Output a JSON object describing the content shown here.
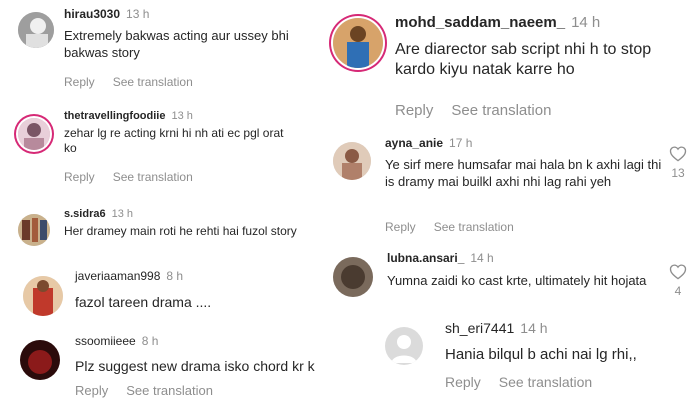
{
  "comments": [
    {
      "username": "hirau3030",
      "time": "13 h",
      "text": "Extremely bakwas acting aur ussey bhi bakwas story",
      "reply": "Reply",
      "translate": "See translation"
    },
    {
      "username": "thetravellingfoodiie",
      "time": "13 h",
      "text": "zehar lg re acting krni hi nh ati ec pgl orat ko",
      "reply": "Reply",
      "translate": "See translation"
    },
    {
      "username": "s.sidra6",
      "time": "13 h",
      "text": "Her dramey main roti he rehti hai fuzol story"
    },
    {
      "username": "javeriaaman998",
      "time": "8 h",
      "text": "fazol tareen drama ...."
    },
    {
      "username": "ssoomiieee",
      "time": "8 h",
      "text": "Plz suggest new drama isko chord kr k",
      "reply": "Reply",
      "translate": "See translation"
    },
    {
      "username": "mohd_saddam_naeem_",
      "time": "14 h",
      "text": "Are diarector sab script nhi h to stop kardo kiyu natak karre ho",
      "reply": "Reply",
      "translate": "See translation"
    },
    {
      "username": "ayna_anie",
      "time": "17 h",
      "text": "Ye sirf mere humsafar mai hala bn k axhi lagi thi is dramy mai builkl axhi nhi lag rahi yeh",
      "reply": "Reply",
      "translate": "See translation",
      "likes": "13"
    },
    {
      "username": "lubna.ansari_",
      "time": "14 h",
      "text": "Yumna zaidi ko cast krte, ultimately hit hojata",
      "likes": "4"
    },
    {
      "username": "sh_eri7441",
      "time": "14 h",
      "text": "Hania bilqul b achi nai lg rhi,,",
      "reply": "Reply",
      "translate": "See translation"
    }
  ],
  "icons": {
    "heart": "heart-outline-icon",
    "avatar_placeholder": "default-avatar-icon"
  },
  "colors": {
    "username": "#262626",
    "meta": "#8e8e8e",
    "story_ring": "#d62976"
  }
}
